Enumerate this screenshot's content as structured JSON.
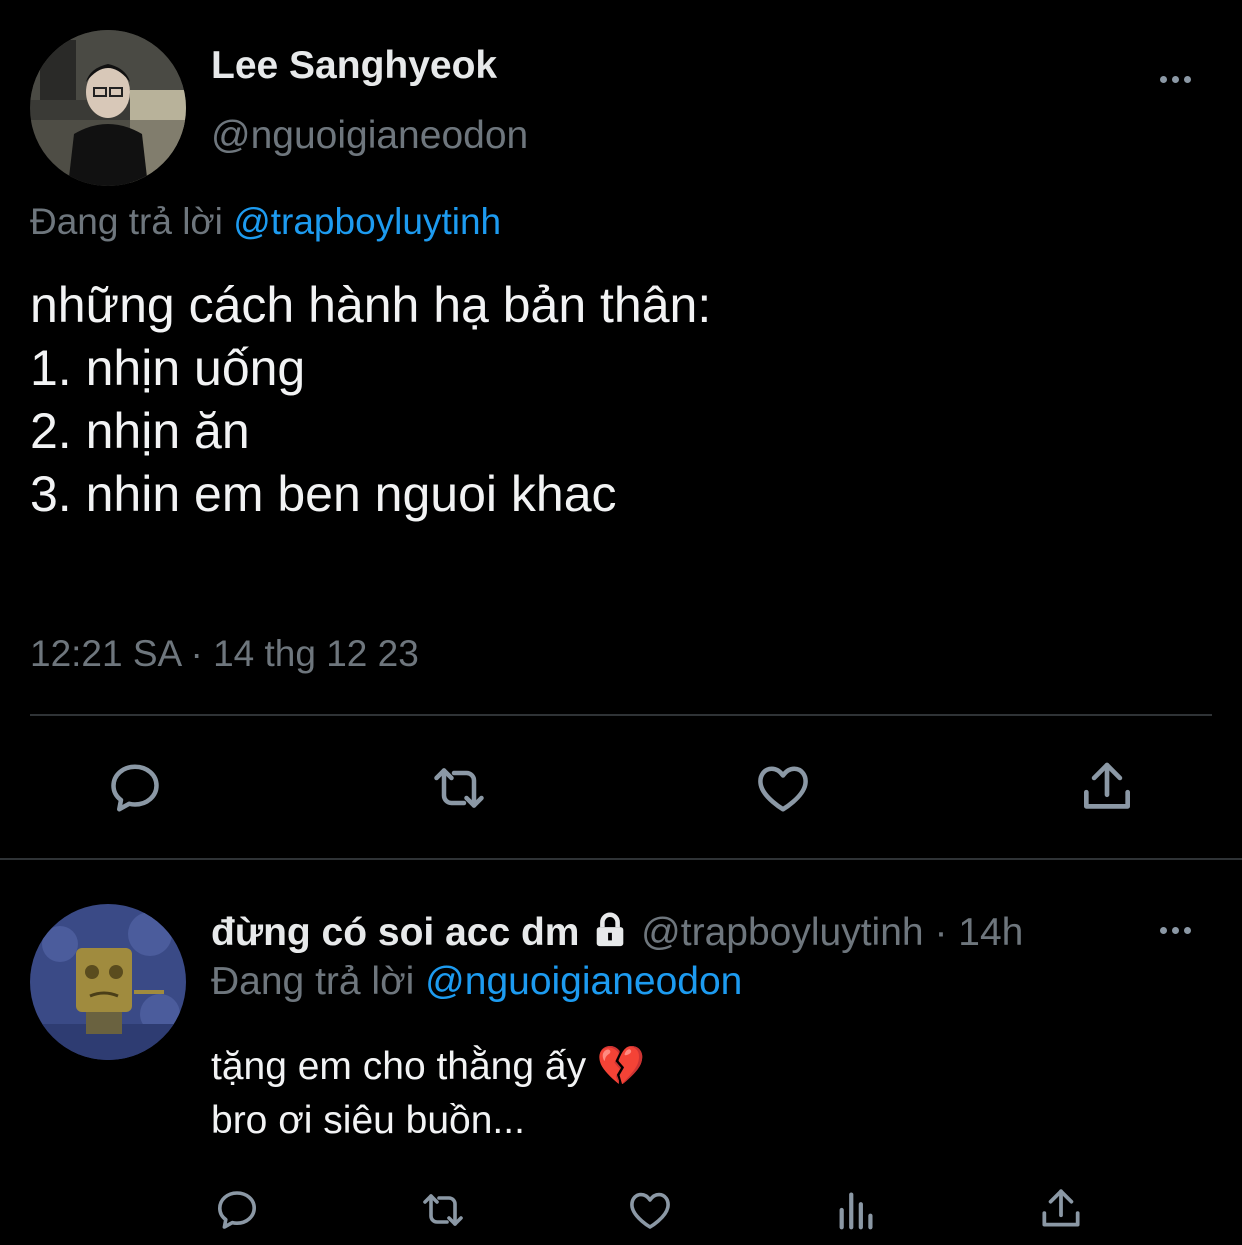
{
  "main_tweet": {
    "display_name": "Lee Sanghyeok",
    "handle": "@nguoigianeodon",
    "replying_label": "Đang trả lời",
    "replying_to": "@trapboyluytinh",
    "text": "những cách hành hạ bản thân:\n1. nhịn uống\n2. nhịn ăn\n3. nhin em ben nguoi khac",
    "timestamp": "12:21 SA · 14 thg 12 23"
  },
  "reply": {
    "display_name": "đừng có soi acc dm",
    "handle": "@trapboyluytinh",
    "time": "· 14h",
    "replying_label": "Đang trả lời",
    "replying_to": "@nguoigianeodon",
    "text": "tặng em cho thằng ấy 💔\nbro ơi siêu buồn..."
  },
  "icons": {
    "main_actions": [
      "reply-icon",
      "retweet-icon",
      "like-icon",
      "share-icon"
    ],
    "reply_actions": [
      "reply-icon",
      "retweet-icon",
      "like-icon",
      "views-icon",
      "share-icon"
    ],
    "other": [
      "more-icon",
      "lock-icon",
      "broken-heart-emoji"
    ]
  },
  "colors": {
    "background": "#000000",
    "text": "#e7e9ea",
    "muted": "#6e767d",
    "link": "#1d9bf0",
    "icon": "#8b98a5",
    "divider": "#2f3336"
  }
}
